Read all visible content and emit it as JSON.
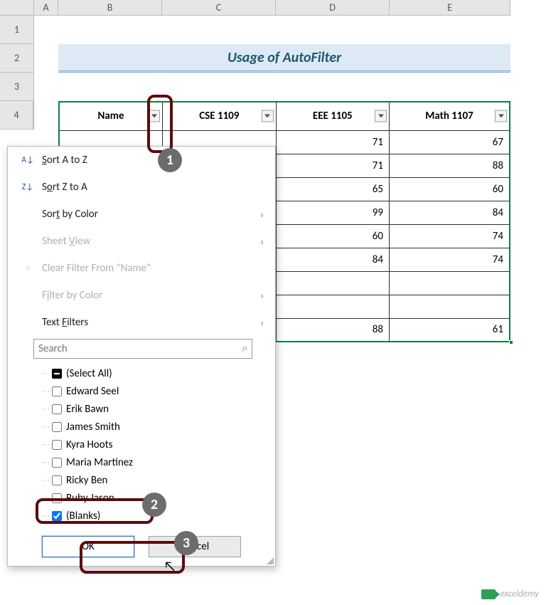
{
  "columns": {
    "a": "A",
    "b": "B",
    "c": "C",
    "d": "D",
    "e": "E"
  },
  "rows": {
    "r1": "1",
    "r2": "2",
    "r3": "3",
    "r4": "4"
  },
  "title": "Usage of AutoFilter",
  "table": {
    "headers": {
      "name": "Name",
      "c": "CSE 1109",
      "d": "EEE 1105",
      "e": "Math 1107"
    },
    "rows": [
      {
        "d": "71",
        "e": "67"
      },
      {
        "d": "71",
        "e": "88"
      },
      {
        "d": "65",
        "e": "60"
      },
      {
        "d": "99",
        "e": "84"
      },
      {
        "d": "60",
        "e": "74"
      },
      {
        "d": "84",
        "e": "74"
      },
      {
        "d": "",
        "e": ""
      },
      {
        "d": "",
        "e": ""
      },
      {
        "d": "88",
        "e": "61"
      }
    ]
  },
  "menu": {
    "sort_az": "Sort A to Z",
    "sort_za": "Sort Z to A",
    "sort_color": "Sort by Color",
    "sheet_view": "Sheet View",
    "clear_filter": "Clear Filter From \"Name\"",
    "filter_color": "Filter by Color",
    "text_filters": "Text Filters",
    "search_placeholder": "Search",
    "items": [
      "(Select All)",
      "Edward Seel",
      "Erik Bawn",
      "James Smith",
      "Kyra Hoots",
      "Maria Martinez",
      "Ricky Ben",
      "Ruby Jason",
      "(Blanks)"
    ],
    "ok": "OK",
    "cancel": "Cancel"
  },
  "badges": {
    "b1": "1",
    "b2": "2",
    "b3": "3"
  },
  "watermark": "exceldemy"
}
